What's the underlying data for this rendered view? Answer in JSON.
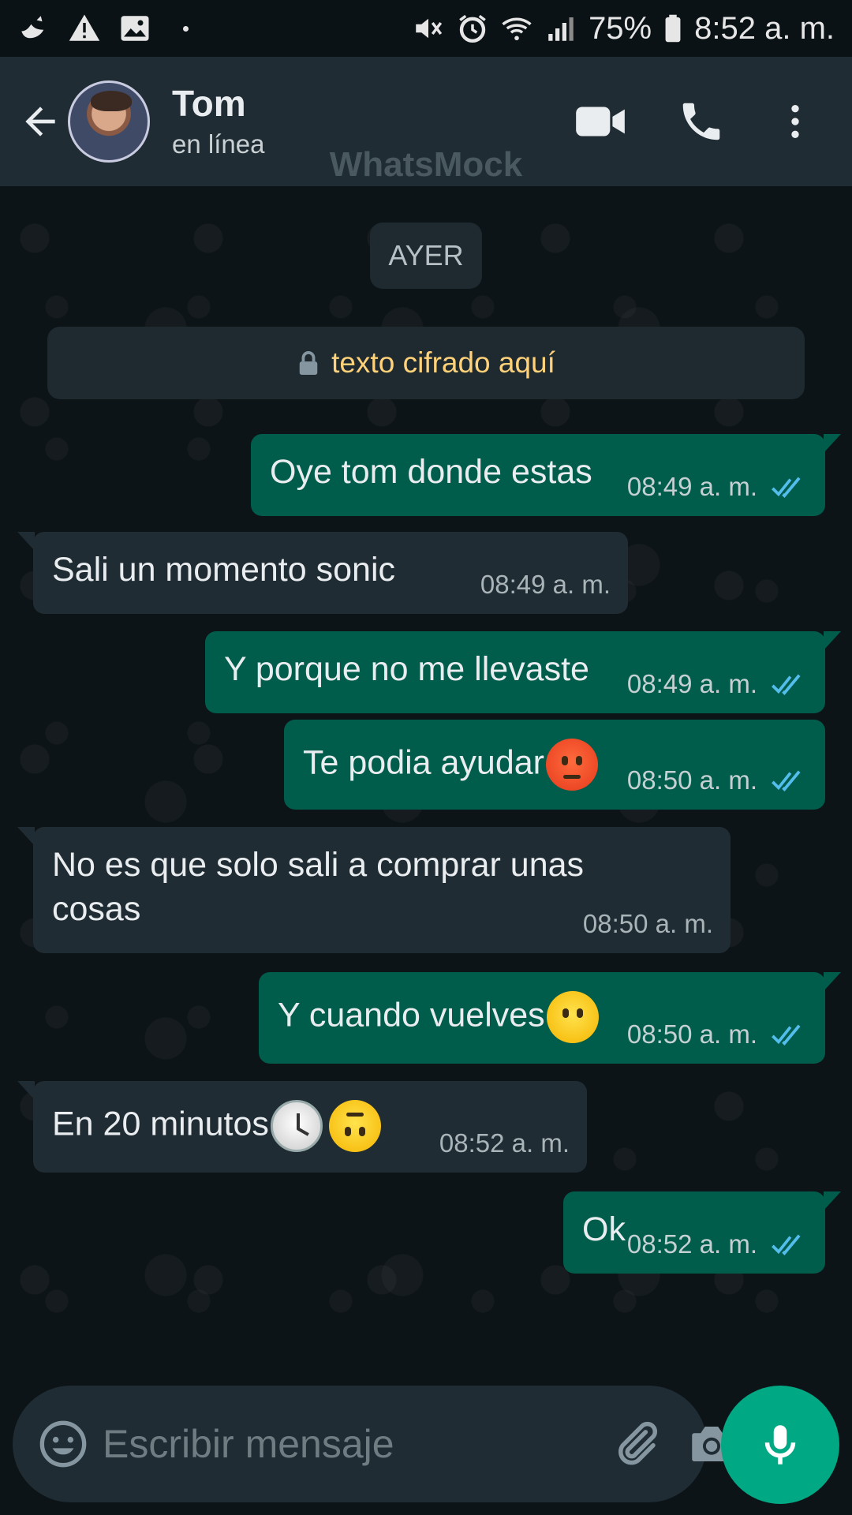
{
  "status_bar": {
    "battery": "75%",
    "time": "8:52 a. m.",
    "icons_left": [
      "bird-notification-icon",
      "warning-icon",
      "image-icon"
    ],
    "icons_right": [
      "mute-icon",
      "alarm-icon",
      "wifi-icon",
      "signal-icon",
      "battery-icon"
    ]
  },
  "header": {
    "contact_name": "Tom",
    "contact_status": "en línea",
    "watermark": "WhatsMock",
    "icons": [
      "back-arrow-icon",
      "video-call-icon",
      "phone-icon",
      "more-options-icon"
    ]
  },
  "chat": {
    "date_chip": "AYER",
    "encryption_note": "texto cifrado aquí",
    "messages": [
      {
        "direction": "out",
        "text": "Oye tom donde estas",
        "time": "08:49 a. m.",
        "read": true
      },
      {
        "direction": "in",
        "text": "Sali un momento sonic",
        "time": "08:49 a. m."
      },
      {
        "direction": "out",
        "text": "Y porque no me llevaste",
        "time": "08:49 a. m.",
        "read": true
      },
      {
        "direction": "out",
        "text": "Te podia ayudar",
        "emoji": [
          "angry-face"
        ],
        "time": "08:50 a. m.",
        "read": true
      },
      {
        "direction": "in",
        "text_line1": "No es que solo sali a comprar unas",
        "text_line2": "cosas",
        "time": "08:50 a. m."
      },
      {
        "direction": "out",
        "text": "Y cuando vuelves",
        "emoji": [
          "face-without-mouth"
        ],
        "time": "08:50 a. m.",
        "read": true
      },
      {
        "direction": "in",
        "text": "En 20 minutos",
        "emoji": [
          "clock",
          "upside-down-face"
        ],
        "time": "08:52 a. m."
      },
      {
        "direction": "out",
        "text": "Ok",
        "time": "08:52 a. m.",
        "read": true
      }
    ]
  },
  "composer": {
    "placeholder": "Escribir mensaje",
    "icons": [
      "emoji-icon",
      "attach-icon",
      "camera-icon",
      "mic-icon"
    ]
  },
  "colors": {
    "outgoing_bubble": "#005c4b",
    "incoming_bubble": "#202c33",
    "header_bg": "#1f2c33",
    "accent": "#00a884",
    "read_ticks": "#53bdeb",
    "encryption_text": "#ffd279"
  }
}
